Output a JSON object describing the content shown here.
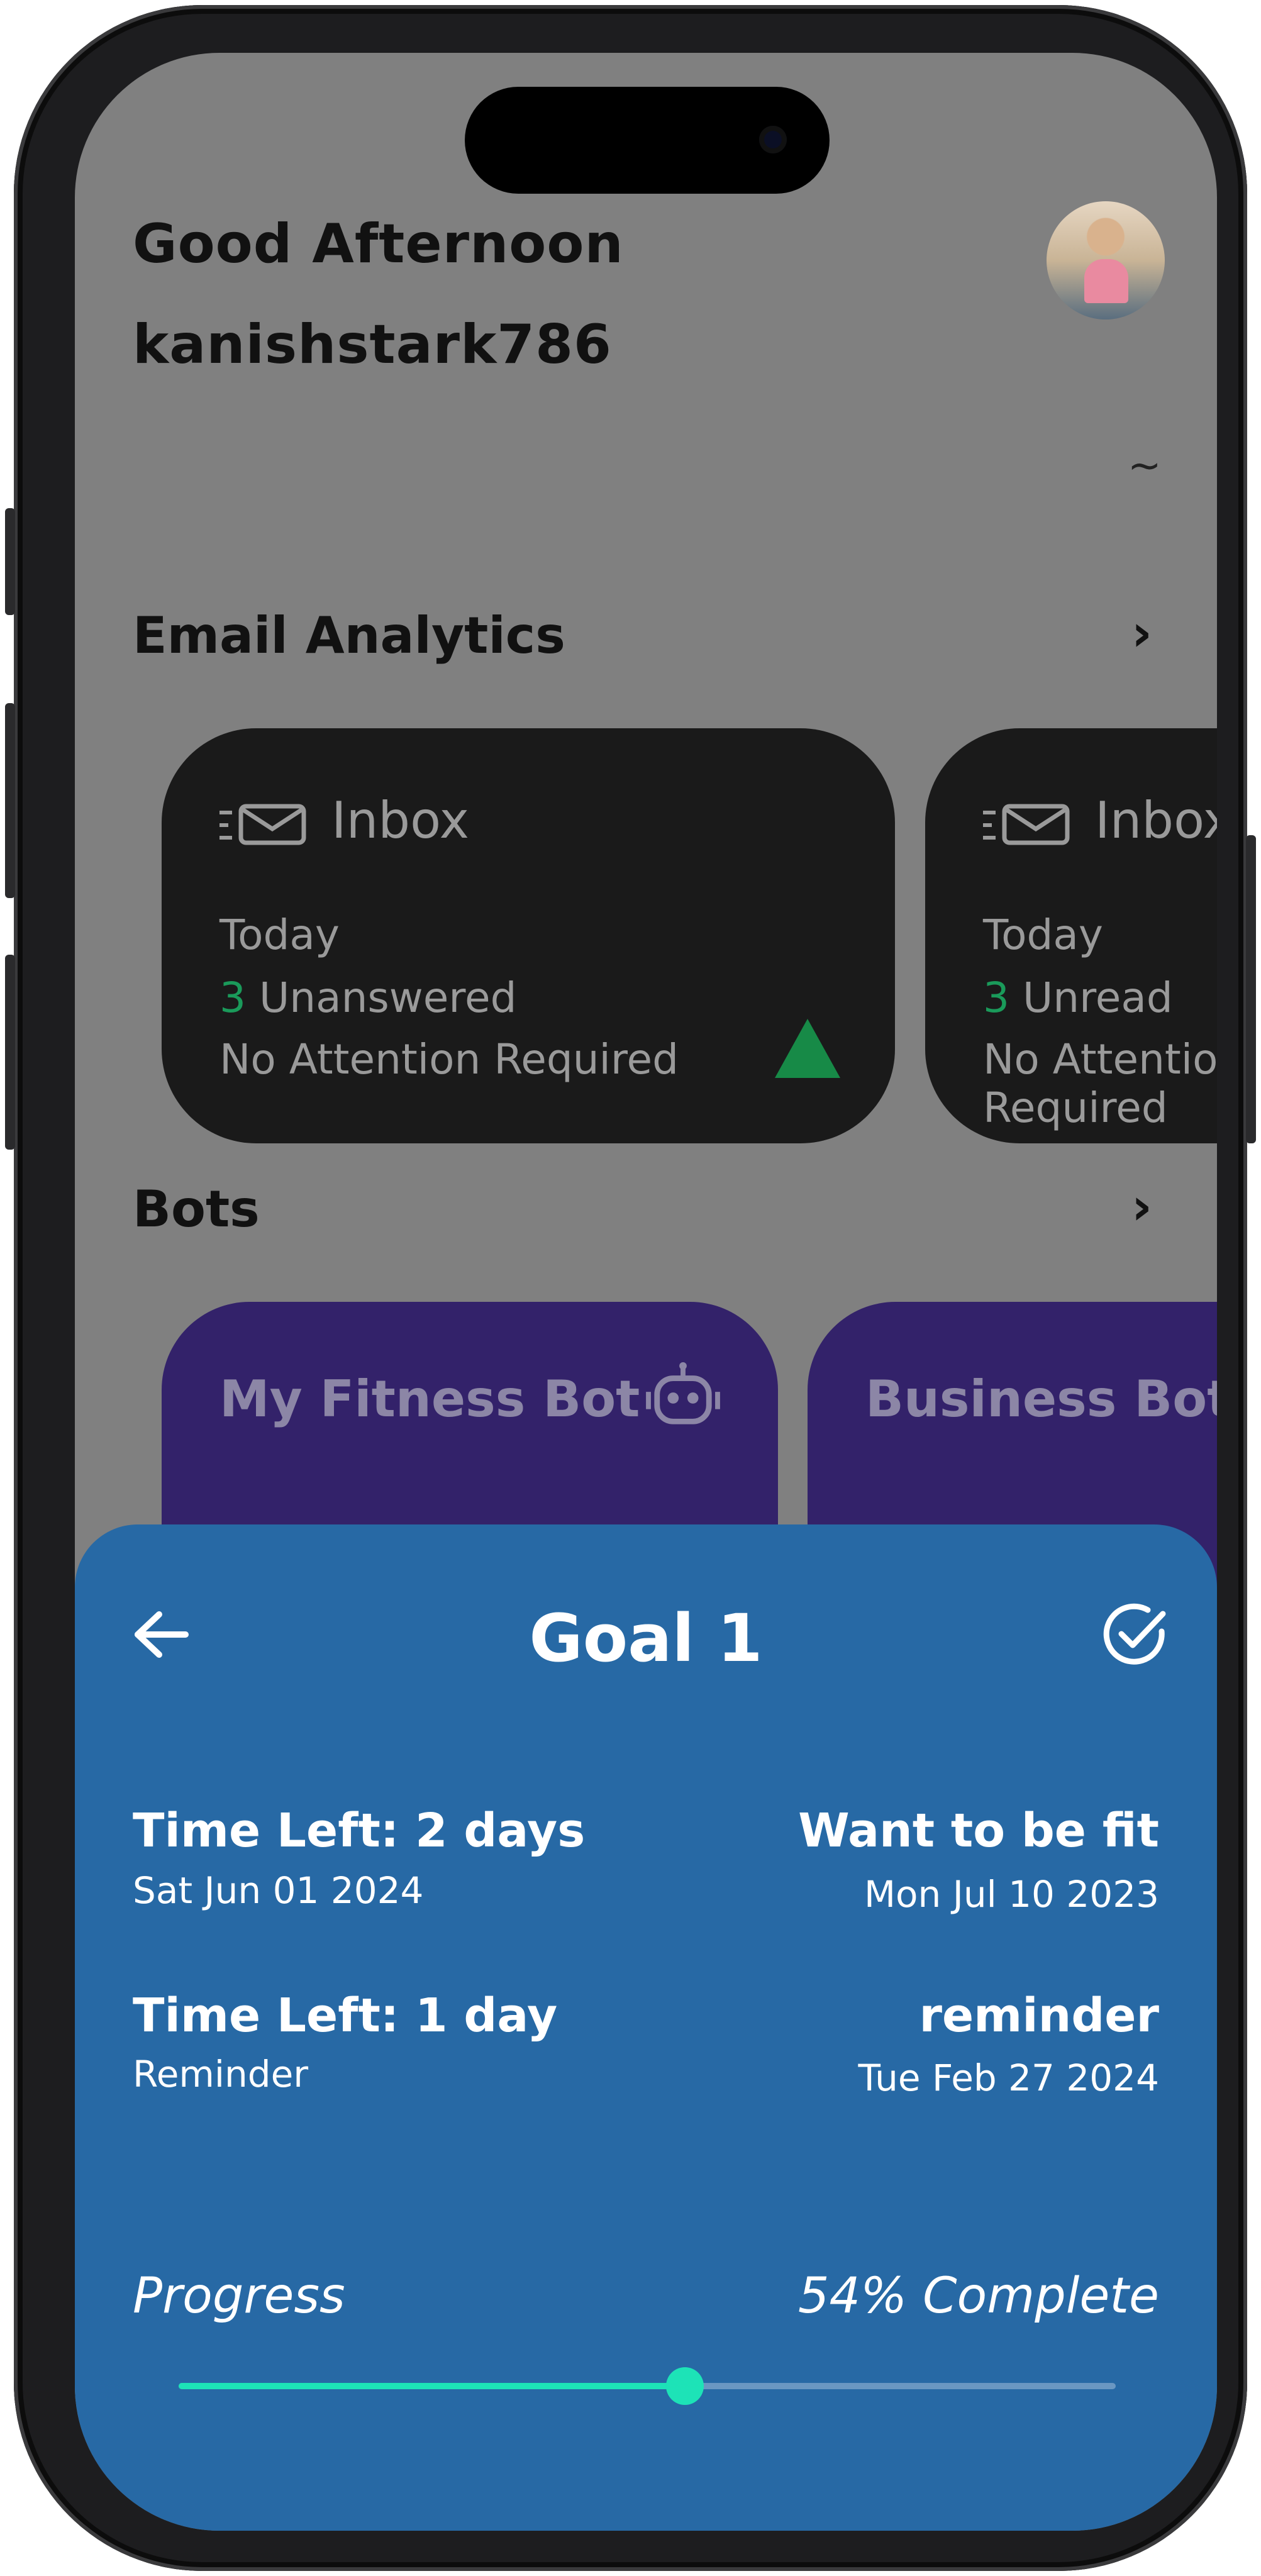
{
  "greeting": {
    "line1": "Good Afternoon",
    "username": "kanishstark786",
    "tilde": "~"
  },
  "email_analytics": {
    "title": "Email Analytics",
    "chevron": "›",
    "cards": [
      {
        "title": "Inbox",
        "period": "Today",
        "count": "3",
        "metric": "Unanswered",
        "status": "No Attention Required",
        "trend_icon": "triangle-up-icon"
      },
      {
        "title": "Inbox",
        "period": "Today",
        "count": "3",
        "metric": "Unread",
        "status": "No Attention Required"
      }
    ]
  },
  "bots": {
    "title": "Bots",
    "chevron": "›",
    "items": [
      {
        "name": "My Fitness Bot",
        "icon": "robot-icon"
      },
      {
        "name": "Business Bot"
      }
    ]
  },
  "sheet": {
    "title": "Goal 1",
    "back_icon": "arrow-left-icon",
    "check_icon": "check-circle-icon",
    "rows": [
      {
        "left_main": "Time Left: 2 days",
        "left_sub": "Sat Jun 01 2024",
        "right_main": "Want to be fit",
        "right_sub": "Mon Jul 10 2023"
      },
      {
        "left_main": "Time Left: 1 day",
        "left_sub": "Reminder",
        "right_main": "reminder",
        "right_sub": "Tue Feb 27 2024"
      }
    ],
    "progress": {
      "label": "Progress",
      "value_text": "54% Complete",
      "fraction": 0.54
    }
  },
  "colors": {
    "sheet_bg": "#2769a5",
    "progress_fill": "#1de3b7",
    "bot_card": "#33226a",
    "card_bg": "#1a1a1a",
    "accent_green": "#1a9a5a"
  }
}
